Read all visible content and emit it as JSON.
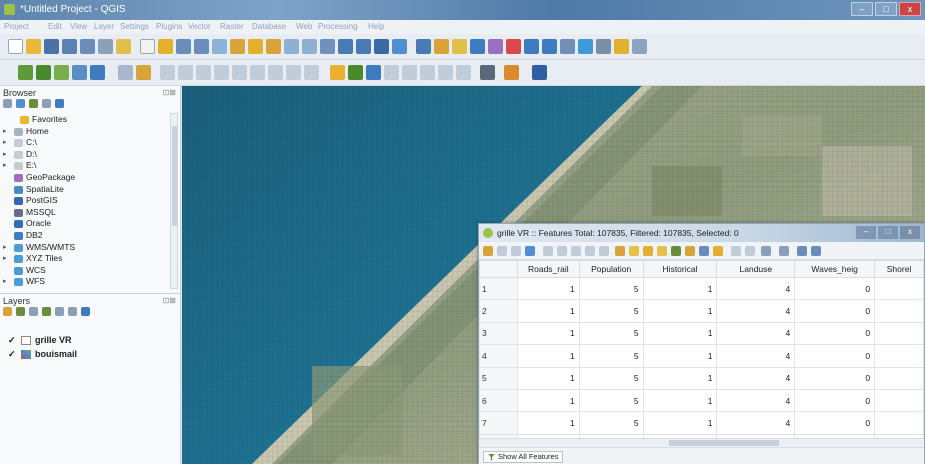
{
  "window": {
    "title": "*Untitled Project - QGIS"
  },
  "menu": [
    "Project",
    "Edit",
    "View",
    "Layer",
    "Settings",
    "Plugins",
    "Vector",
    "Raster",
    "Database",
    "Web",
    "Processing",
    "Help"
  ],
  "browser": {
    "title": "Browser",
    "items": [
      {
        "label": "Favorites",
        "icon": "star-icon",
        "color": "#e8b830",
        "expandable": false
      },
      {
        "label": "Home",
        "icon": "home-folder-icon",
        "color": "#a8b4c2",
        "expandable": true
      },
      {
        "label": "C:\\",
        "icon": "drive-icon",
        "color": "#c8ccd2",
        "expandable": true
      },
      {
        "label": "D:\\",
        "icon": "drive-icon",
        "color": "#c8ccd2",
        "expandable": true
      },
      {
        "label": "E:\\",
        "icon": "drive-icon",
        "color": "#c8ccd2",
        "expandable": true
      },
      {
        "label": "GeoPackage",
        "icon": "geopackage-icon",
        "color": "#9c6fbf",
        "expandable": false
      },
      {
        "label": "SpatiaLite",
        "icon": "spatialite-icon",
        "color": "#4a8bbf",
        "expandable": false
      },
      {
        "label": "PostGIS",
        "icon": "postgis-icon",
        "color": "#3468a8",
        "expandable": false
      },
      {
        "label": "MSSQL",
        "icon": "mssql-icon",
        "color": "#6a6a8c",
        "expandable": false
      },
      {
        "label": "Oracle",
        "icon": "oracle-icon",
        "color": "#2f6fb3",
        "expandable": false
      },
      {
        "label": "DB2",
        "icon": "db2-icon",
        "color": "#3f7bc0",
        "expandable": false
      },
      {
        "label": "WMS/WMTS",
        "icon": "globe-icon",
        "color": "#4a9bd8",
        "expandable": true
      },
      {
        "label": "XYZ Tiles",
        "icon": "globe-icon",
        "color": "#4a9bd8",
        "expandable": true
      },
      {
        "label": "WCS",
        "icon": "globe-icon",
        "color": "#4a9bd8",
        "expandable": false
      },
      {
        "label": "WFS",
        "icon": "globe-icon",
        "color": "#4a9bd8",
        "expandable": true
      }
    ]
  },
  "layers": {
    "title": "Layers",
    "items": [
      {
        "label": "grille VR",
        "checked": "✓",
        "icon": "polygon-layer-icon"
      },
      {
        "label": "bouismail",
        "checked": "✓",
        "icon": "raster-layer-icon"
      }
    ]
  },
  "attribute_table": {
    "title": "grille VR :: Features Total: 107835, Filtered: 107835, Selected: 0",
    "columns": [
      "Roads_rail",
      "Population",
      "Historical",
      "Landuse",
      "Waves_heig",
      "Shorel"
    ],
    "rows": [
      {
        "n": "1",
        "cells": [
          "1",
          "5",
          "1",
          "4",
          "0",
          ""
        ]
      },
      {
        "n": "2",
        "cells": [
          "1",
          "5",
          "1",
          "4",
          "0",
          ""
        ]
      },
      {
        "n": "3",
        "cells": [
          "1",
          "5",
          "1",
          "4",
          "0",
          ""
        ]
      },
      {
        "n": "4",
        "cells": [
          "1",
          "5",
          "1",
          "4",
          "0",
          ""
        ]
      },
      {
        "n": "5",
        "cells": [
          "1",
          "5",
          "1",
          "4",
          "0",
          ""
        ]
      },
      {
        "n": "6",
        "cells": [
          "1",
          "5",
          "1",
          "4",
          "0",
          ""
        ]
      },
      {
        "n": "7",
        "cells": [
          "1",
          "5",
          "1",
          "4",
          "0",
          ""
        ]
      },
      {
        "n": "8",
        "cells": [
          "1",
          "5",
          "1",
          "4",
          "0",
          ""
        ]
      }
    ],
    "show_all_label": "Show All Features"
  },
  "colors": {
    "sea": "#1f6f8c",
    "titlebar": "#5d84ad",
    "accent": "#9bc24a"
  }
}
